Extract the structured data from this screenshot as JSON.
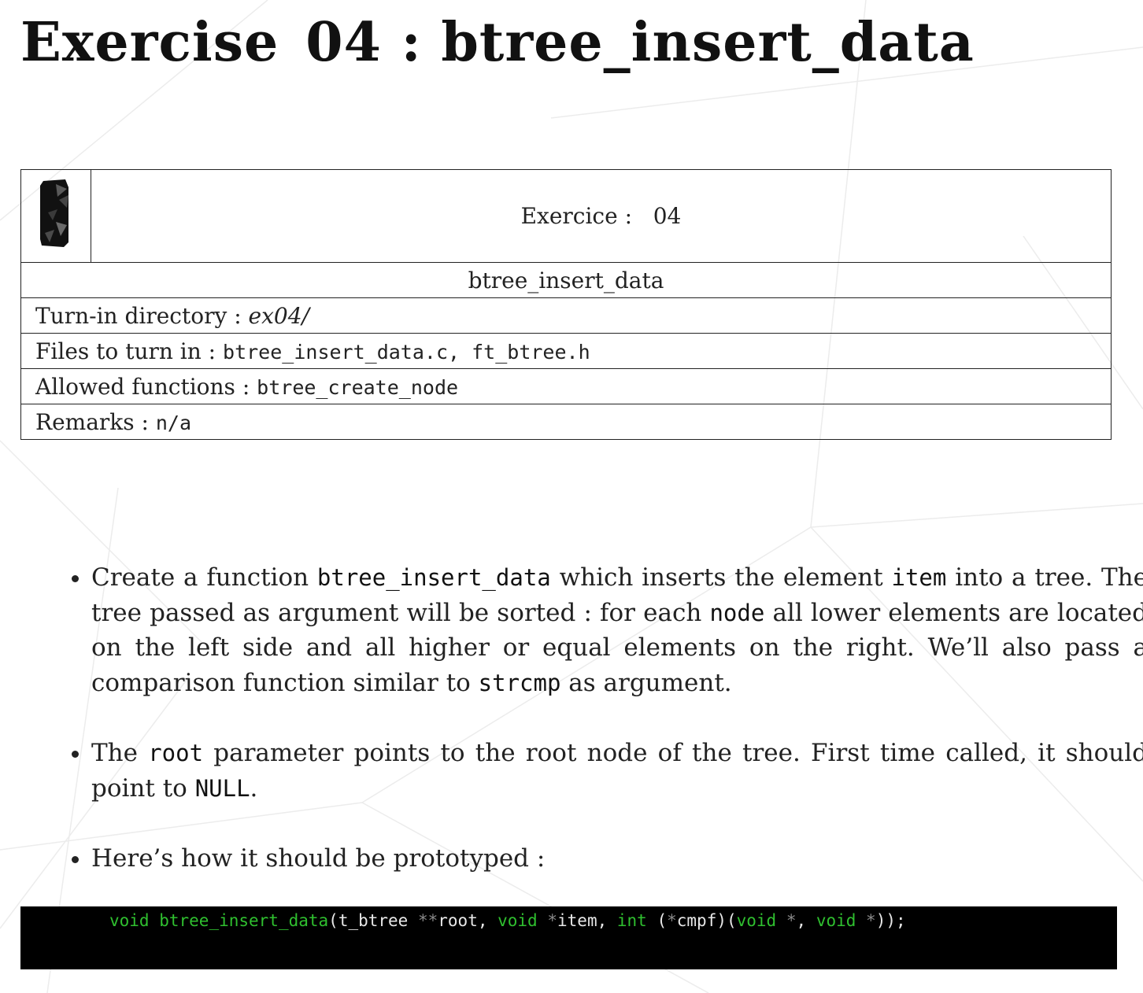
{
  "header": {
    "title_prefix": "Exercise",
    "title_number": "04",
    "title_sep": ":",
    "title_name": "btree_insert_data"
  },
  "info_table": {
    "exercise_label": "Exercice :",
    "exercise_number": "04",
    "function_name": "btree_insert_data",
    "turnin_label": "Turn-in directory :",
    "turnin_value": "ex04/",
    "files_label": "Files to turn in :",
    "files_value": "btree_insert_data.c, ft_btree.h",
    "allowed_label": "Allowed functions :",
    "allowed_value": "btree_create_node",
    "remarks_label": "Remarks :",
    "remarks_value": "n/a"
  },
  "bullets": {
    "b1": {
      "t1": "Create a function ",
      "c1": "btree_insert_data",
      "t2": " which inserts the element ",
      "c2": "item",
      "t3": " into a tree. The tree passed as argument will be sorted : for each ",
      "c3": "node",
      "t4": " all lower elements are located on the left side and all higher or equal elements on the right. We’ll also pass a comparison function similar to ",
      "c4": "strcmp",
      "t5": " as argument."
    },
    "b2": {
      "t1": "The ",
      "c1": "root",
      "t2": " parameter points to the root node of the tree. First time called, it should point to ",
      "c2": "NULL",
      "t3": "."
    },
    "b3": {
      "t1": "Here’s how it should be prototyped :"
    }
  },
  "code": {
    "kw_void": "void",
    "fn_name": "btree_insert_data",
    "p1": "(t_btree ",
    "op_dstar": "**",
    "p2": "root, ",
    "op_star": "*",
    "p3": "item, ",
    "kw_int": "int",
    "p4": " (",
    "p5": "cmpf)(",
    "p6": " ",
    "p7": ", ",
    "p8": "));"
  },
  "colors": {
    "code_background": "#000000",
    "code_keyword": "#2fbf2f",
    "code_operator": "#8a8a8a",
    "code_text": "#e8e8e8"
  }
}
